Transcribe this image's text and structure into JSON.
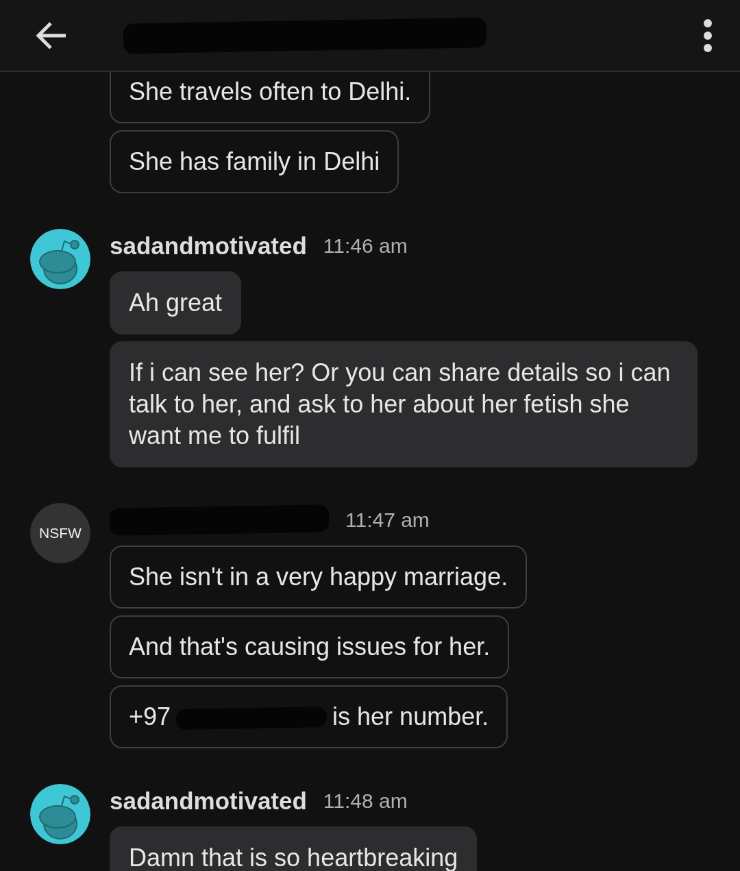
{
  "groups": [
    {
      "kind": "received",
      "messages": [
        {
          "kind": "text",
          "text": "She travels often to Delhi."
        },
        {
          "kind": "text",
          "text": "She has family in Delhi"
        }
      ]
    },
    {
      "kind": "sent",
      "avatar": {
        "kind": "snoo"
      },
      "username": "sadandmotivated",
      "time": "11:46 am",
      "messages": [
        {
          "kind": "text",
          "text": "Ah great"
        },
        {
          "kind": "text",
          "text": "If i can see her? Or you can share details so i can talk to her, and ask to her about her fetish she want me to fulfil"
        }
      ]
    },
    {
      "kind": "received",
      "avatar": {
        "kind": "label",
        "label": "NSFW"
      },
      "username_redacted": true,
      "time": "11:47 am",
      "messages": [
        {
          "kind": "text",
          "text": "She isn't in a very happy marriage."
        },
        {
          "kind": "text",
          "text": "And that's causing issues for her."
        },
        {
          "kind": "redacted",
          "before": "+97",
          "after": "is her number."
        }
      ]
    },
    {
      "kind": "sent",
      "avatar": {
        "kind": "snoo"
      },
      "username": "sadandmotivated",
      "time": "11:48 am",
      "messages": [
        {
          "kind": "text",
          "text": "Damn that is so heartbreaking"
        }
      ]
    }
  ]
}
